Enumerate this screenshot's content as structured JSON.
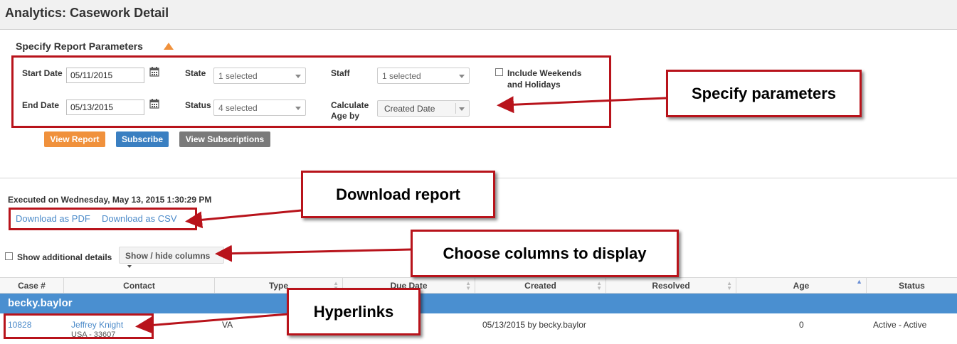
{
  "page": {
    "title": "Analytics: Casework Detail"
  },
  "params": {
    "section_title": "Specify Report Parameters",
    "start_date_label": "Start Date",
    "start_date_value": "05/11/2015",
    "end_date_label": "End Date",
    "end_date_value": "05/13/2015",
    "state_label": "State",
    "state_value": "1 selected",
    "status_label": "Status",
    "status_value": "4 selected",
    "staff_label": "Staff",
    "staff_value": "1 selected",
    "calc_label_1": "Calculate",
    "calc_label_2": "Age by",
    "calc_value": "Created Date",
    "weekends_label_1": "Include Weekends",
    "weekends_label_2": "and Holidays",
    "weekends_checked": false
  },
  "buttons": {
    "view_report": "View Report",
    "subscribe": "Subscribe",
    "view_subscriptions": "View Subscriptions"
  },
  "report": {
    "executed": "Executed on Wednesday, May 13, 2015 1:30:29 PM",
    "download_pdf": "Download as PDF",
    "download_csv": "Download as CSV",
    "show_details_label": "Show additional details",
    "show_hide_columns": "Show / hide columns"
  },
  "table": {
    "columns": [
      "Case #",
      "Contact",
      "Type",
      "Due Date",
      "Created",
      "Resolved",
      "Age",
      "Status"
    ],
    "group": "becky.baylor",
    "row": {
      "case": "10828",
      "contact": "Jeffrey Knight",
      "contact_sub": "USA - 33607",
      "type": "VA",
      "created": "05/13/2015 by becky.baylor",
      "age": "0",
      "status": "Active - Active"
    }
  },
  "callouts": {
    "specify": "Specify parameters",
    "download": "Download report",
    "columns": "Choose columns to display",
    "hyperlinks": "Hyperlinks"
  },
  "colors": {
    "accent_orange": "#f0913c",
    "subscribe_blue": "#3a7fc1",
    "view_subs_gray": "#7a7a7a",
    "group_blue": "#4a8fd0",
    "callout_red": "#b8131b",
    "link_blue": "#4b8ac9"
  }
}
